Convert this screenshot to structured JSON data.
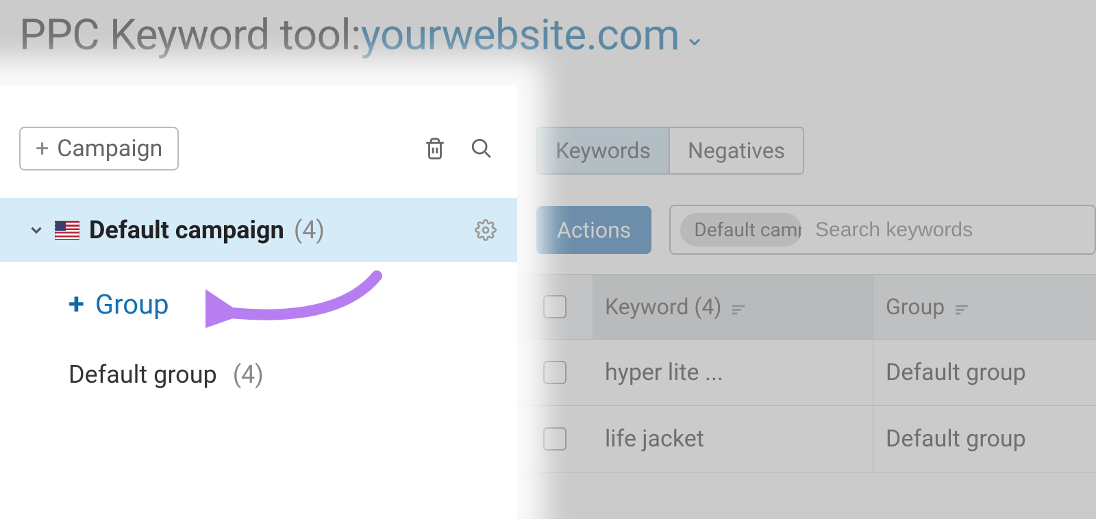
{
  "header": {
    "title_prefix": "PPC Keyword tool:",
    "domain": "yourwebsite.com"
  },
  "sidebar": {
    "add_campaign_label": "Campaign",
    "campaign": {
      "name": "Default campaign",
      "count": "(4)"
    },
    "add_group_label": "Group",
    "default_group": {
      "name": "Default group",
      "count": "(4)"
    }
  },
  "right": {
    "tabs": {
      "keywords": "Keywords",
      "negatives": "Negatives"
    },
    "actions_label": "Actions",
    "chip_label": "Default campa",
    "search_placeholder": "Search keywords",
    "columns": {
      "keyword": "Keyword (4)",
      "group": "Group"
    },
    "rows": [
      {
        "keyword": "hyper lite ...",
        "group": "Default group"
      },
      {
        "keyword": "life jacket",
        "group": "Default group"
      }
    ]
  }
}
